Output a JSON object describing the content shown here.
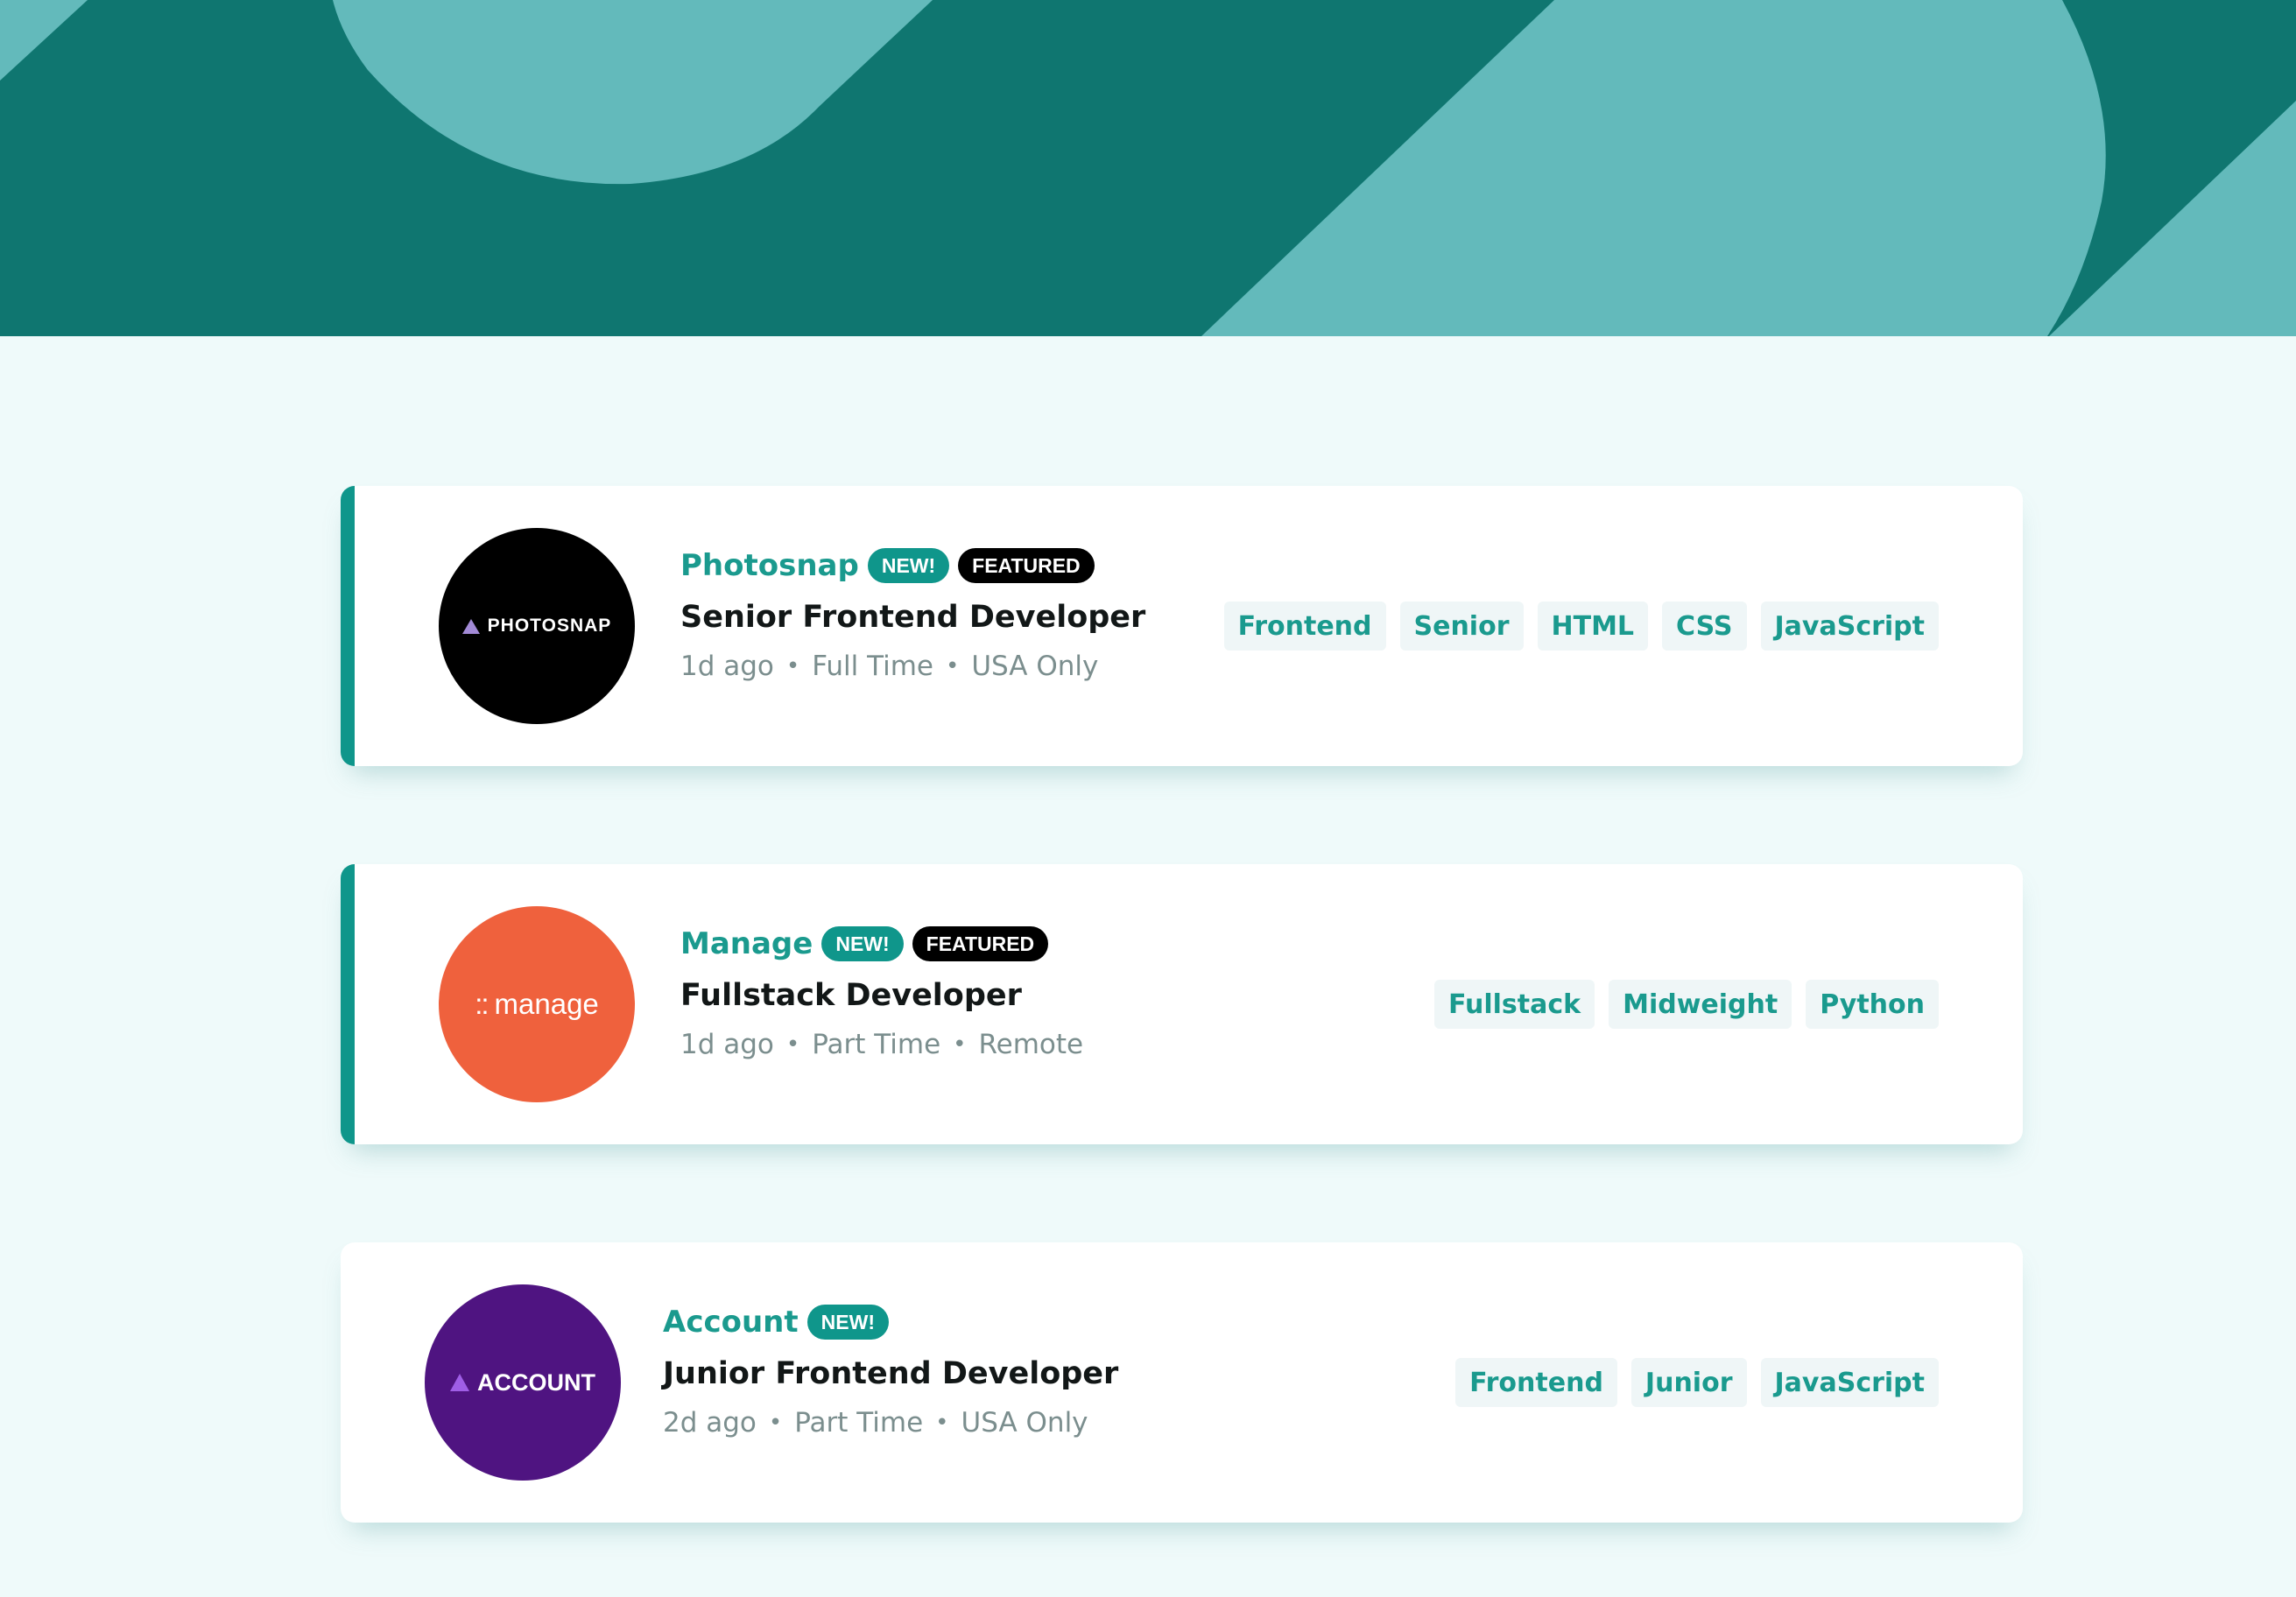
{
  "colors": {
    "header_dark": "#0f7670",
    "header_light": "#63babb",
    "page_background": "#effafa",
    "accent": "#0f968b",
    "tag_background": "#eff6f7"
  },
  "listings": [
    {
      "company": "Photosnap",
      "logo_text": "PHOTOSNAP",
      "logo_icon": "triangle-icon",
      "new_badge": "NEW!",
      "featured_badge": "FEATURED",
      "position": "Senior Frontend Developer",
      "posted": "1d ago",
      "contract": "Full Time",
      "location": "USA Only",
      "tags": [
        "Frontend",
        "Senior",
        "HTML",
        "CSS",
        "JavaScript"
      ]
    },
    {
      "company": "Manage",
      "logo_text": "manage",
      "logo_icon": "dots-icon",
      "new_badge": "NEW!",
      "featured_badge": "FEATURED",
      "position": "Fullstack Developer",
      "posted": "1d ago",
      "contract": "Part Time",
      "location": "Remote",
      "tags": [
        "Fullstack",
        "Midweight",
        "Python"
      ]
    },
    {
      "company": "Account",
      "logo_text": "ACCOUNT",
      "logo_icon": "triangle-icon",
      "new_badge": "NEW!",
      "position": "Junior Frontend Developer",
      "posted": "2d ago",
      "contract": "Part Time",
      "location": "USA Only",
      "tags": [
        "Frontend",
        "Junior",
        "JavaScript"
      ]
    }
  ]
}
